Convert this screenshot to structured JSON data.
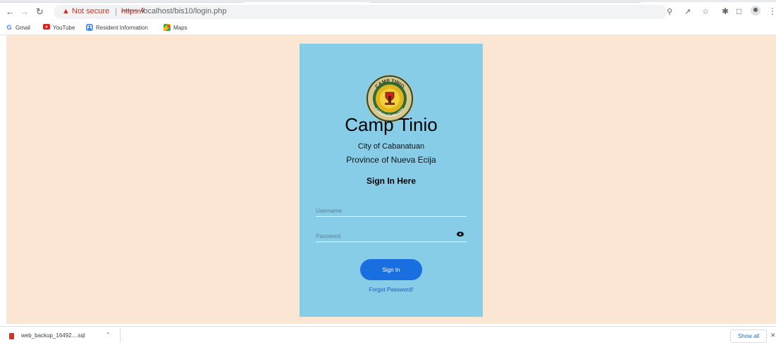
{
  "browser": {
    "security_label": "Not secure",
    "url_scheme": "https://",
    "url_rest": "localhost/bis10/login.php",
    "bookmarks": [
      {
        "label": "Gmail",
        "icon": "gmail-icon"
      },
      {
        "label": "YouTube",
        "icon": "youtube-icon"
      },
      {
        "label": "Resident Information",
        "icon": "resident-icon"
      },
      {
        "label": "Maps",
        "icon": "maps-icon"
      }
    ]
  },
  "login": {
    "logo_top_text": "CAMP TINIO",
    "logo_bottom_text": "CABANATUAN CITY",
    "title": "Camp Tinio",
    "city": "City of Cabanatuan",
    "province": "Province of Nueva Ecija",
    "heading": "Sign In Here",
    "username_placeholder": "Username",
    "password_placeholder": "Password",
    "submit_label": "Sign In",
    "forgot_label": "Forgot Password!"
  },
  "downloads": {
    "file_name": "web_backup_16492....sql",
    "show_all_label": "Show all"
  },
  "colors": {
    "page_background": "#fbe6d3",
    "card_background": "#87cde8",
    "button": "#1a6fe0",
    "link": "#1a55c7",
    "warning": "#d93025"
  }
}
